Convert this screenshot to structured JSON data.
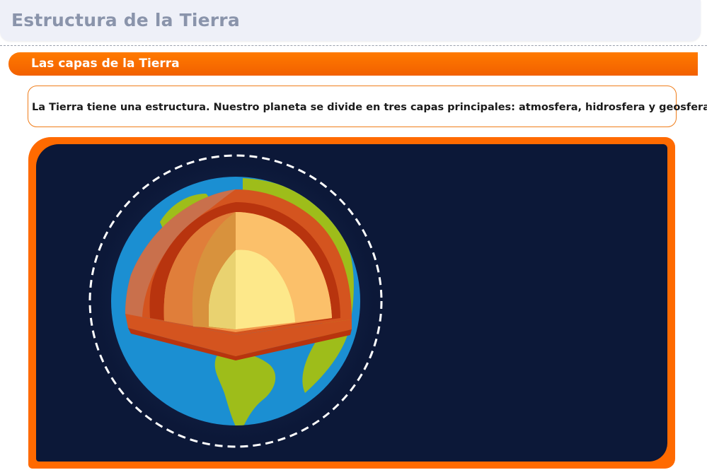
{
  "page": {
    "title": "Estructura de la Tierra"
  },
  "section": {
    "title": "Las capas de la Tierra"
  },
  "intro": {
    "text": "La Tierra tiene una estructura. Nuestro planeta se divide en tres capas principales: atmosfera, hidrosfera y geosfera."
  },
  "illustration": {
    "subject": "earth-cross-section",
    "colors": {
      "background": "#0c1838",
      "frame": "#ff6a00",
      "ocean": "#1b8fd2",
      "land": "#9ebd1a",
      "crust": "#d4541f",
      "mantle": "#f39a4c",
      "outer_core": "#fbc06a",
      "inner_core": "#fde88a"
    }
  }
}
